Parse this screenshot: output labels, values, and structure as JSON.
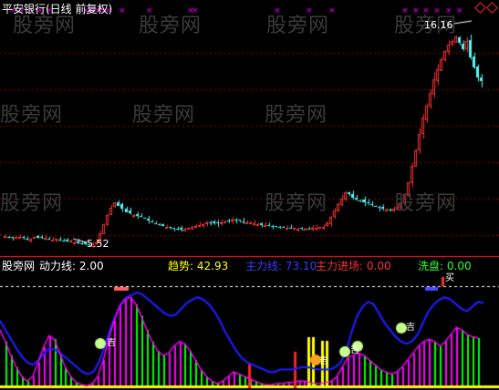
{
  "header": {
    "title": "平安银行(日线 前复权)"
  },
  "price_panel": {
    "high_label": "16.16",
    "low_label": "5.52"
  },
  "indicator_bar": {
    "source": "股旁网",
    "items": [
      {
        "key": "动力线",
        "value": "2.00",
        "color": "#ffffff"
      },
      {
        "key": "趋势",
        "value": "42.93",
        "color": "#ffff00"
      },
      {
        "key": "主力线",
        "value": "73.10",
        "color": "#1c1cff"
      },
      {
        "key": "主力进场",
        "value": "0.00",
        "color": "#ff3030"
      },
      {
        "key": "洗盘",
        "value": "0.00",
        "color": "#30ff30"
      }
    ]
  },
  "signals": {
    "buy_label": "买",
    "tag_label": "吉"
  },
  "watermarks": [
    "股旁网",
    "股旁网",
    "股旁网",
    "股旁网",
    "股旁网",
    "股旁网",
    "股旁网",
    "股旁网",
    "股旁网",
    "股旁网"
  ],
  "colors": {
    "up": "#ff3232",
    "down": "#54fcfc",
    "main_line": "#1c1cff",
    "trend": "#ff00ff",
    "wash": "#00ff00",
    "grid": "#8b0000"
  },
  "chart_data": [
    {
      "type": "candlestick",
      "title": "平安银行(日线 前复权)",
      "ylim": [
        5.0,
        16.8
      ],
      "annotations": {
        "max": 16.16,
        "min": 5.52
      },
      "close": [
        5.95,
        5.9,
        5.85,
        5.88,
        5.92,
        5.87,
        5.8,
        5.83,
        5.9,
        5.88,
        5.84,
        5.86,
        5.82,
        5.78,
        5.8,
        5.76,
        5.72,
        5.68,
        5.7,
        5.65,
        5.6,
        5.58,
        5.55,
        5.52,
        5.6,
        5.65,
        6.1,
        6.55,
        7.0,
        7.35,
        7.6,
        7.45,
        7.3,
        7.15,
        7.05,
        7.0,
        6.95,
        6.9,
        6.8,
        6.7,
        6.62,
        6.55,
        6.5,
        6.45,
        6.4,
        6.35,
        6.3,
        6.28,
        6.25,
        6.3,
        6.35,
        6.4,
        6.45,
        6.5,
        6.55,
        6.6,
        6.62,
        6.58,
        6.55,
        6.6,
        6.65,
        6.7,
        6.75,
        6.72,
        6.68,
        6.65,
        6.62,
        6.6,
        6.58,
        6.55,
        6.5,
        6.48,
        6.45,
        6.42,
        6.4,
        6.38,
        6.36,
        6.35,
        6.34,
        6.33,
        6.32,
        6.31,
        6.3,
        6.32,
        6.34,
        6.36,
        6.38,
        6.4,
        6.6,
        6.9,
        7.2,
        7.5,
        7.8,
        8.1,
        8.0,
        7.85,
        7.75,
        7.7,
        7.6,
        7.55,
        7.45,
        7.4,
        7.35,
        7.3,
        7.25,
        7.2,
        7.3,
        7.4,
        7.6,
        8.0,
        8.6,
        9.4,
        10.2,
        11.0,
        11.8,
        12.4,
        13.0,
        13.7,
        14.2,
        14.7,
        15.1,
        15.4,
        15.6,
        15.8,
        15.5,
        15.2,
        15.6,
        14.8,
        14.3,
        13.8,
        13.6
      ],
      "grid_lines": [
        6.0,
        7.8,
        9.6,
        11.4,
        13.2,
        15.0
      ]
    },
    {
      "type": "line",
      "title": "",
      "ylim": [
        0,
        100
      ],
      "series": [
        {
          "name": "主力线",
          "color": "#1c1cff",
          "last": 73.1,
          "values": [
            58,
            50,
            42,
            34,
            27,
            22,
            20,
            24,
            30,
            34,
            33,
            30,
            26,
            22,
            18,
            14,
            12,
            14,
            22,
            35,
            50,
            62,
            72,
            78,
            80,
            82,
            80,
            76,
            72,
            68,
            64,
            62,
            63,
            68,
            73,
            76,
            78,
            76,
            72,
            66,
            58,
            48,
            40,
            32,
            26,
            22,
            20,
            18,
            16,
            14,
            14,
            16,
            16,
            16,
            17,
            18,
            18,
            17,
            16,
            16,
            16,
            18,
            22,
            32,
            48,
            62,
            70,
            74,
            72,
            64,
            56,
            50,
            44,
            40,
            38,
            40,
            46,
            56,
            66,
            72,
            76,
            78,
            76,
            72,
            68,
            66,
            70,
            74,
            73
          ]
        },
        {
          "name": "趋势",
          "color": "#ff00ff",
          "last": 42.93,
          "values": [
            50,
            40,
            28,
            18,
            10,
            6,
            10,
            22,
            35,
            45,
            42,
            30,
            18,
            10,
            5,
            3,
            2,
            4,
            10,
            24,
            42,
            58,
            70,
            76,
            78,
            72,
            62,
            50,
            40,
            32,
            28,
            30,
            36,
            40,
            38,
            32,
            24,
            16,
            10,
            6,
            4,
            6,
            10,
            14,
            12,
            10,
            8,
            6,
            4,
            3,
            3,
            4,
            4,
            5,
            5,
            6,
            6,
            5,
            4,
            4,
            5,
            6,
            10,
            18,
            26,
            28,
            30,
            28,
            24,
            20,
            16,
            14,
            12,
            14,
            18,
            24,
            30,
            36,
            40,
            42,
            40,
            36,
            40,
            46,
            52,
            50,
            46,
            44,
            42.93
          ]
        }
      ],
      "buy_signal_index": 72,
      "grid_lines": [
        40
      ]
    }
  ]
}
